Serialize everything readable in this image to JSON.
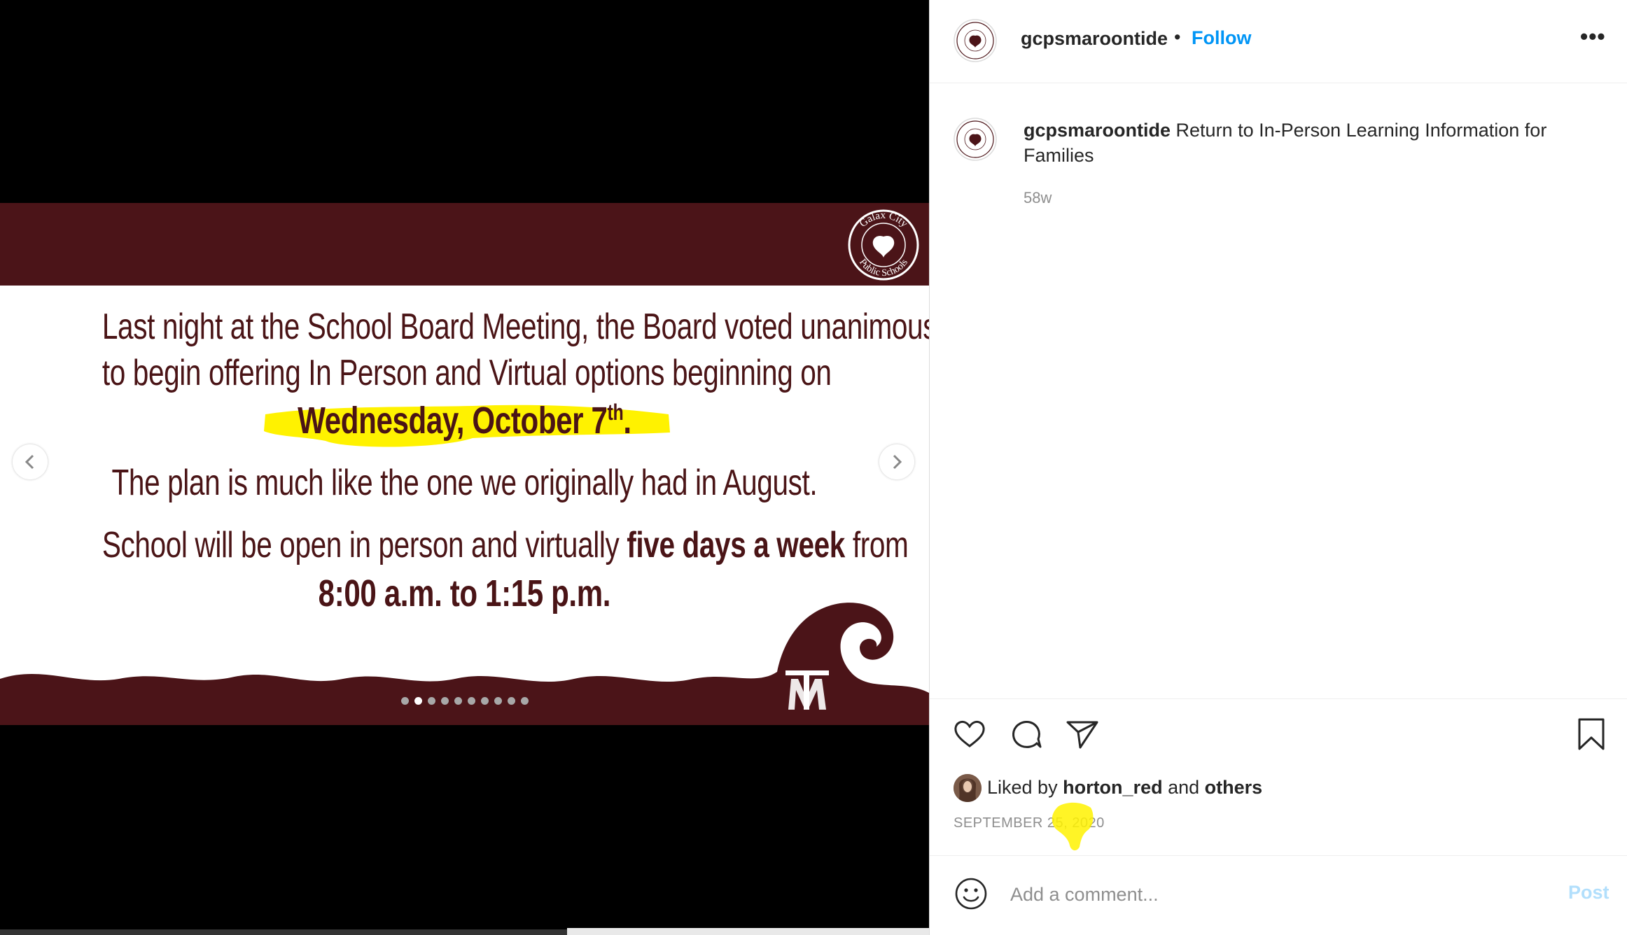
{
  "post": {
    "username": "gcpsmaroontide",
    "follow_label": "Follow",
    "separator": "•",
    "more_label": "•••",
    "caption_user": "gcpsmaroontide",
    "caption_text": " Return to In-Person Learning Information for Families",
    "time_ago": "58w",
    "liked_by_prefix": "Liked by ",
    "liked_by_user": "horton_red",
    "liked_by_and": " and ",
    "liked_by_others": "others",
    "date_prefix": "SEPTEMBER 25, ",
    "date_year": "2020",
    "comment_placeholder": "Add a comment...",
    "post_label": "Post",
    "avatar_seal_text": "Galax City Public Schools"
  },
  "slide": {
    "line1": "Last night at the School Board Meeting, the Board voted unanimously",
    "line2": "to begin offering In Person and Virtual options beginning on",
    "line3_main": "Wednesday, October 7",
    "line3_sup": "th",
    "line3_end": ".",
    "line4": "The plan is much like the one we originally had in August.",
    "line5_a": "School will be open in person and virtually ",
    "line5_b": "five days a week",
    "line5_c": " from",
    "line6": "8:00 a.m. to 1:15 p.m.",
    "seal_top": "Galax City",
    "seal_bottom": "Public Schools",
    "tm_logo": "TM",
    "total_slides": 10,
    "active_slide": 2
  },
  "colors": {
    "maroon": "#4b1418",
    "text_maroon": "#4a1416",
    "highlight": "#fff200",
    "ig_blue": "#0095f6",
    "post_disabled": "#b2dffc"
  },
  "icons": {
    "prev": "chevron-left-icon",
    "next": "chevron-right-icon",
    "like": "heart-icon",
    "comment": "comment-bubble-icon",
    "share": "paper-plane-icon",
    "save": "bookmark-icon",
    "emoji": "smiley-icon"
  }
}
